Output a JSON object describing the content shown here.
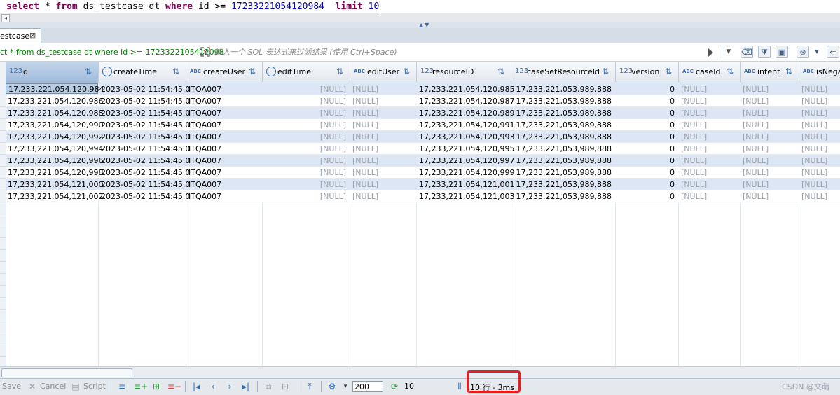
{
  "editor": {
    "sql_parts": [
      {
        "t": "select",
        "cls": "kw"
      },
      {
        "t": " * ",
        "cls": ""
      },
      {
        "t": "from",
        "cls": "kw"
      },
      {
        "t": " ds_testcase dt ",
        "cls": ""
      },
      {
        "t": "where",
        "cls": "kw"
      },
      {
        "t": " id >= ",
        "cls": ""
      },
      {
        "t": "17233221054120984",
        "cls": "num"
      },
      {
        "t": "  ",
        "cls": ""
      },
      {
        "t": "limit",
        "cls": "kw"
      },
      {
        "t": " ",
        "cls": ""
      },
      {
        "t": "10",
        "cls": "num"
      }
    ]
  },
  "tab": {
    "label": "estcase",
    "close": "⊠"
  },
  "filter": {
    "query": "ct * from ds_testcase dt where id >= 1723322105412098",
    "placeholder": "输入一个 SQL 表达式来过滤结果 (使用 Ctrl+Space)"
  },
  "grid": {
    "columns": [
      {
        "name": "id",
        "type": "123",
        "type_kind": "num"
      },
      {
        "name": "createTime",
        "type": "clock",
        "type_kind": "clock"
      },
      {
        "name": "createUser",
        "type": "ABC",
        "type_kind": "abc"
      },
      {
        "name": "editTime",
        "type": "clock",
        "type_kind": "clock"
      },
      {
        "name": "editUser",
        "type": "ABC",
        "type_kind": "abc"
      },
      {
        "name": "resourceID",
        "type": "123",
        "type_kind": "num"
      },
      {
        "name": "caseSetResourceId",
        "type": "123",
        "type_kind": "num"
      },
      {
        "name": "version",
        "type": "123",
        "type_kind": "num"
      },
      {
        "name": "caseId",
        "type": "ABC",
        "type_kind": "abc"
      },
      {
        "name": "intent",
        "type": "ABC",
        "type_kind": "abc"
      },
      {
        "name": "isNega",
        "type": "ABC",
        "type_kind": "abc"
      }
    ],
    "rows": [
      [
        "17,233,221,054,120,984",
        "2023-05-02 11:54:45.0",
        "ITQA007",
        "[NULL]",
        "[NULL]",
        "17,233,221,054,120,985",
        "17,233,221,053,989,888",
        "0",
        "[NULL]",
        "[NULL]",
        "[NULL]"
      ],
      [
        "17,233,221,054,120,986",
        "2023-05-02 11:54:45.0",
        "ITQA007",
        "[NULL]",
        "[NULL]",
        "17,233,221,054,120,987",
        "17,233,221,053,989,888",
        "0",
        "[NULL]",
        "[NULL]",
        "[NULL]"
      ],
      [
        "17,233,221,054,120,988",
        "2023-05-02 11:54:45.0",
        "ITQA007",
        "[NULL]",
        "[NULL]",
        "17,233,221,054,120,989",
        "17,233,221,053,989,888",
        "0",
        "[NULL]",
        "[NULL]",
        "[NULL]"
      ],
      [
        "17,233,221,054,120,990",
        "2023-05-02 11:54:45.0",
        "ITQA007",
        "[NULL]",
        "[NULL]",
        "17,233,221,054,120,991",
        "17,233,221,053,989,888",
        "0",
        "[NULL]",
        "[NULL]",
        "[NULL]"
      ],
      [
        "17,233,221,054,120,992",
        "2023-05-02 11:54:45.0",
        "ITQA007",
        "[NULL]",
        "[NULL]",
        "17,233,221,054,120,993",
        "17,233,221,053,989,888",
        "0",
        "[NULL]",
        "[NULL]",
        "[NULL]"
      ],
      [
        "17,233,221,054,120,994",
        "2023-05-02 11:54:45.0",
        "ITQA007",
        "[NULL]",
        "[NULL]",
        "17,233,221,054,120,995",
        "17,233,221,053,989,888",
        "0",
        "[NULL]",
        "[NULL]",
        "[NULL]"
      ],
      [
        "17,233,221,054,120,996",
        "2023-05-02 11:54:45.0",
        "ITQA007",
        "[NULL]",
        "[NULL]",
        "17,233,221,054,120,997",
        "17,233,221,053,989,888",
        "0",
        "[NULL]",
        "[NULL]",
        "[NULL]"
      ],
      [
        "17,233,221,054,120,998",
        "2023-05-02 11:54:45.0",
        "ITQA007",
        "[NULL]",
        "[NULL]",
        "17,233,221,054,120,999",
        "17,233,221,053,989,888",
        "0",
        "[NULL]",
        "[NULL]",
        "[NULL]"
      ],
      [
        "17,233,221,054,121,000",
        "2023-05-02 11:54:45.0",
        "ITQA007",
        "[NULL]",
        "[NULL]",
        "17,233,221,054,121,001",
        "17,233,221,053,989,888",
        "0",
        "[NULL]",
        "[NULL]",
        "[NULL]"
      ],
      [
        "17,233,221,054,121,002",
        "2023-05-02 11:54:45.0",
        "ITQA007",
        "[NULL]",
        "[NULL]",
        "17,233,221,054,121,003",
        "17,233,221,053,989,888",
        "0",
        "[NULL]",
        "[NULL]",
        "[NULL]"
      ]
    ]
  },
  "status": {
    "save_label": "Save",
    "cancel_label": "Cancel",
    "script_label": "Script",
    "fetch_size": "200",
    "refresh_count": "10",
    "row_count": "10 行 - 3ms",
    "watermark": "CSDN @文萌"
  },
  "colors": {
    "keyword": "#7f0055",
    "number": "#0000c0",
    "highlight_box": "#e02020",
    "row_stripe": "#dde6f4"
  }
}
